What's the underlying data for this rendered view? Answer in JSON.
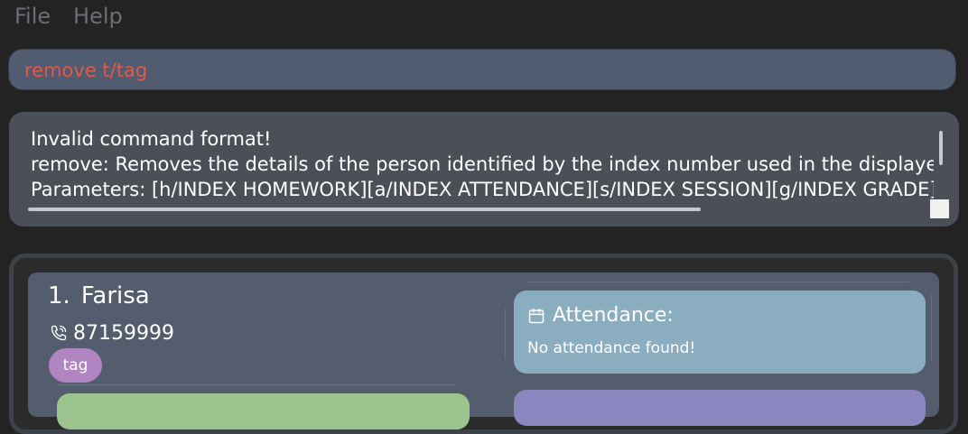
{
  "menu": {
    "file": "File",
    "help": "Help"
  },
  "command": {
    "value": "remove t/tag"
  },
  "result": {
    "lines": [
      "Invalid command format!",
      "remove: Removes the details of the person identified by the index number used in the displayed person list.",
      "Parameters: [h/INDEX HOMEWORK][a/INDEX ATTENDANCE][s/INDEX SESSION][g/INDEX GRADE]"
    ]
  },
  "person": {
    "index": "1.",
    "name": "Farisa",
    "phone": "87159999",
    "tag": "tag",
    "attendance_title": "Attendance:",
    "attendance_body": "No attendance found!"
  },
  "icons": {
    "phone": "phone-icon",
    "calendar": "calendar-icon"
  },
  "colors": {
    "command_text": "#e05a4a",
    "tag": "#b085c2",
    "attendance_card": "#8aaec0",
    "green_card": "#9bc48e",
    "purple_card": "#8b86c0"
  }
}
